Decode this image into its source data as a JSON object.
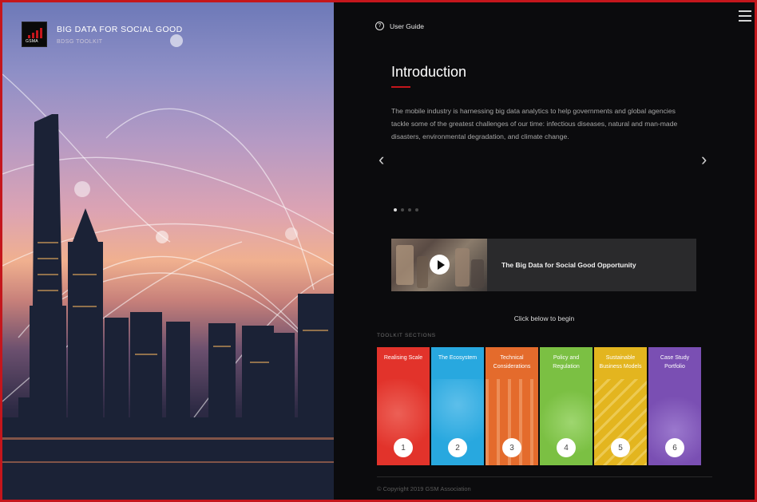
{
  "brand": {
    "logo_text": "GSMA",
    "title": "BIG DATA FOR SOCIAL GOOD",
    "subtitle": "BDSG TOOLKIT"
  },
  "header": {
    "user_guide_label": "User Guide",
    "menu_icon": "hamburger-menu-icon"
  },
  "carousel": {
    "title": "Introduction",
    "text": "The mobile industry is harnessing big data analytics to help governments and global agencies tackle some of the greatest challenges of our time: infectious diseases, natural and man-made disasters, environmental degradation, and climate change.",
    "prev_icon": "chevron-left-icon",
    "next_icon": "chevron-right-icon",
    "total_slides": 4,
    "active_slide": 1
  },
  "video": {
    "title": "The Big Data for Social Good Opportunity",
    "icon": "play-icon"
  },
  "cta": "Click below to begin",
  "sections_label": "TOOLKIT SECTIONS",
  "sections": [
    {
      "title": "Realising Scale",
      "num": "1",
      "color": "#e2332b"
    },
    {
      "title": "The Ecosystem",
      "num": "2",
      "color": "#28a8df"
    },
    {
      "title": "Technical Considerations",
      "num": "3",
      "color": "#e46b2c"
    },
    {
      "title": "Policy and Regulation",
      "num": "4",
      "color": "#7bc043"
    },
    {
      "title": "Sustainable Business Models",
      "num": "5",
      "color": "#e3b51f"
    },
    {
      "title": "Case Study Portfolio",
      "num": "6",
      "color": "#7a4fb3"
    }
  ],
  "footer": {
    "copyright": "© Copyright 2019 GSM Association"
  },
  "colors": {
    "accent": "#c4161c",
    "panel_bg": "#0b0b0d"
  }
}
